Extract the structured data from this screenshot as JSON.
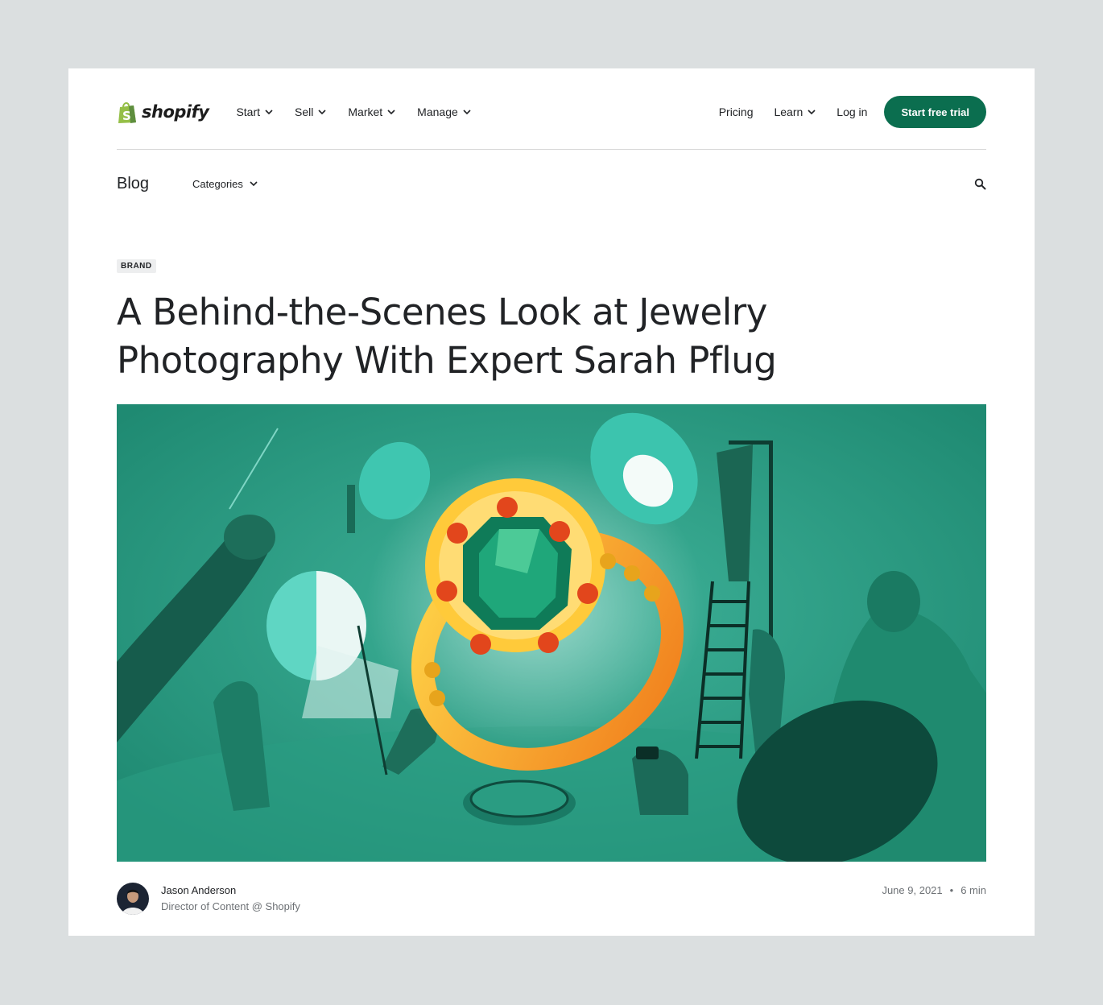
{
  "header": {
    "logo_text": "shopify",
    "nav_left": [
      {
        "label": "Start"
      },
      {
        "label": "Sell"
      },
      {
        "label": "Market"
      },
      {
        "label": "Manage"
      }
    ],
    "nav_right": {
      "pricing": "Pricing",
      "learn": "Learn",
      "login": "Log in",
      "cta": "Start free trial"
    }
  },
  "blog_nav": {
    "title": "Blog",
    "categories": "Categories",
    "search_icon": "search-icon"
  },
  "article": {
    "tag": "BRAND",
    "title": "A Behind-the-Scenes Look at Jewelry Photography With Expert Sarah Pflug",
    "hero_image": "illustration of a giant emerald ring being photographed by a studio crew with lights and reflectors",
    "author": {
      "name": "Jason Anderson",
      "role": "Director of Content @ Shopify"
    },
    "date": "June 9, 2021",
    "separator": "•",
    "read_time": "6 min"
  },
  "colors": {
    "brand_green": "#0b6e4f",
    "logo_green": "#95bf47",
    "hero_teal": "#2a9c82",
    "page_bg": "#dbdfe0"
  }
}
